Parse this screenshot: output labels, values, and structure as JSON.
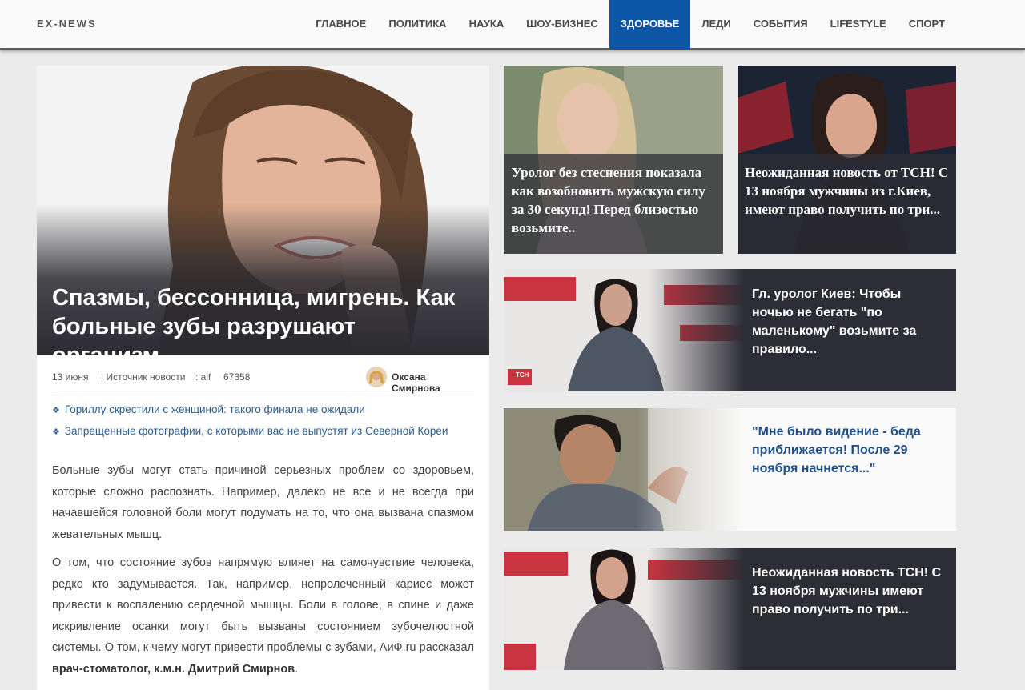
{
  "header": {
    "logo": "EX-NEWS",
    "nav": [
      "ГЛАВНОЕ",
      "ПОЛИТИКА",
      "НАУКА",
      "ШОУ-БИЗНЕС",
      "ЗДОРОВЬЕ",
      "ЛЕДИ",
      "СОБЫТИЯ",
      "LIFESTYLE",
      "СПОРТ"
    ],
    "active_nav": "ЗДОРОВЬЕ"
  },
  "article": {
    "title": "Спазмы, бессонница, мигрень. Как больные зубы разрушают организм",
    "date": "13 июня",
    "source_label": "| Источник новости",
    "source": ": aif",
    "views": "67358",
    "author": "Оксана Смирнова",
    "related": [
      "Гориллу скрестили с женщиной: такого финала не ожидали",
      "Запрещенные фотографии, с которыми вас не выпустят из Северной Кореи"
    ],
    "para1": "Больные зубы могут стать причиной серьезных проблем со здоровьем, которые сложно распознать. Например, далеко не все и не всегда при начавшейся головной боли могут подумать на то, что она вызвана спазмом жевательных мышц.",
    "para2_text": "О том, что состояние зубов напрямую влияет на самочувствие человека, редко кто задумывается. Так, например, непролеченный кариес может привести к воспалению сердечной мышцы. Боли в голове, в спине и даже искривление осанки могут быть вызваны состоянием зубочелюстной системы. О том, к чему могут привести проблемы с зубами, АиФ.ru рассказал ",
    "para2_bold": "врач-стоматолог, к.м.н. Дмитрий Смирнов",
    "para2_end": "."
  },
  "tiles": [
    {
      "title": "Уролог без стеснения показала как возобновить мужскую силу за 30 секунд! Перед близостью возьмите..",
      "style": "dark"
    },
    {
      "title": "Неожиданная новость от ТСН! С 13 ноября мужчины из г.Киев, имеют право получить по три...",
      "style": "dark"
    },
    {
      "title": "Гл. уролог Киев: Чтобы ночью не бегать \"по маленькому\" возьмите за правило...",
      "style": "dark",
      "badge": "ТСН"
    },
    {
      "title": "\"Мне было видение - беда приближается! После 29 ноября начнется...\"",
      "style": "light"
    },
    {
      "title": "Неожиданная новость ТСН! С 13 ноября мужчины имеют право получить по три...",
      "style": "dark"
    }
  ],
  "colors": {
    "accent": "#0d56a6",
    "tile_dark": "#2d2d35",
    "link": "#2c5d8f"
  }
}
